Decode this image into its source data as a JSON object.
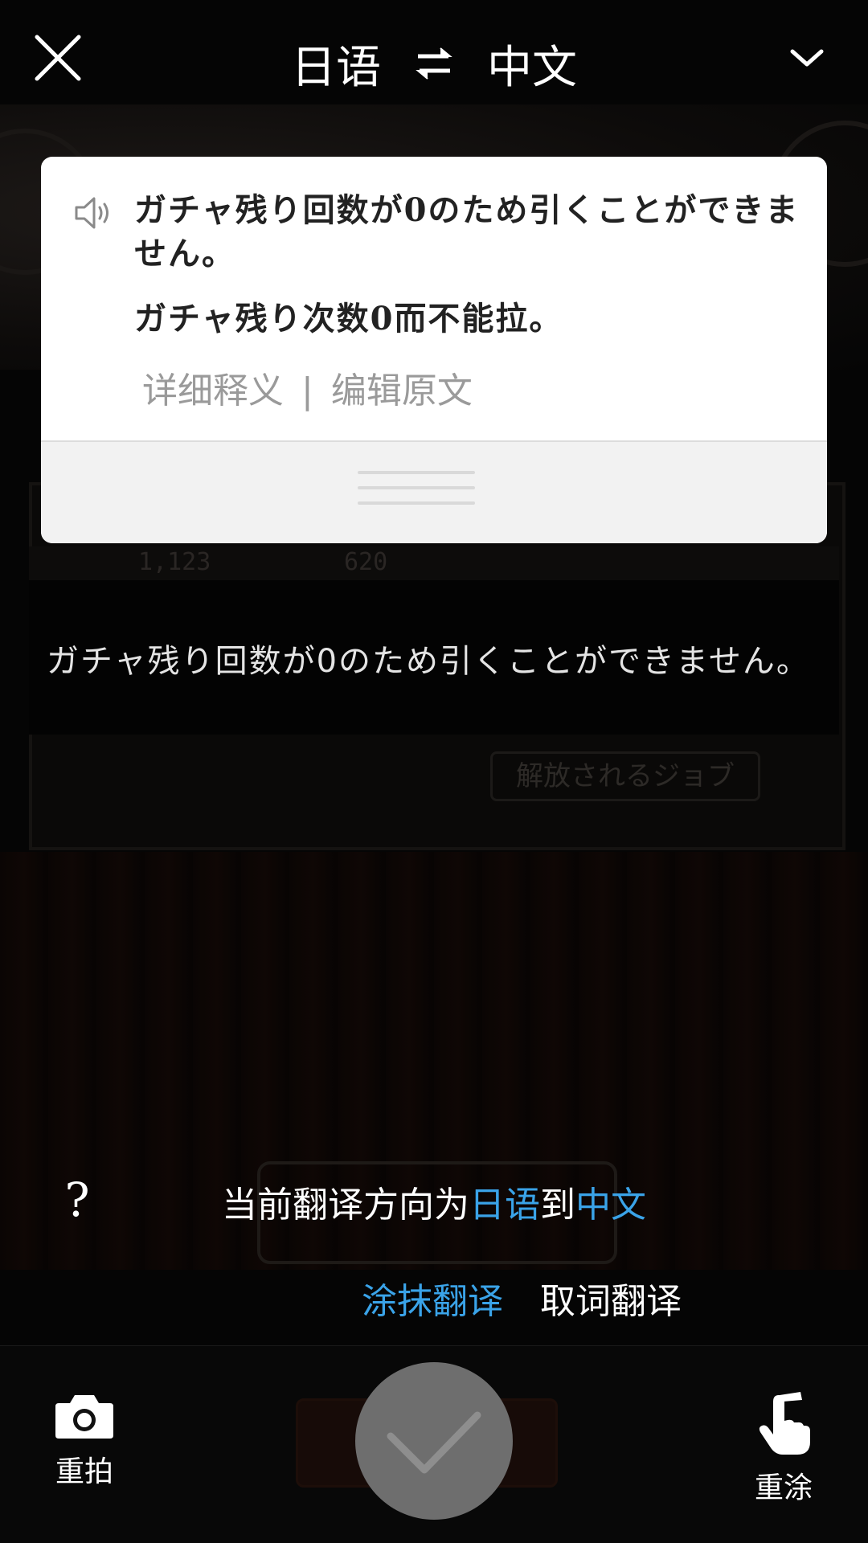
{
  "header": {
    "source_lang": "日语",
    "target_lang": "中文"
  },
  "card": {
    "source_text": "ガチャ残り回数が0のため引くことができません。",
    "translation": "ガチャ残り次数0而不能拉。",
    "detail_link": "详细释义",
    "separator": "|",
    "edit_link": "编辑原文"
  },
  "ocr": {
    "text": "ガチャ残り回数が0のため引くことができません。"
  },
  "background": {
    "stat1": "1,123",
    "stat2": "620",
    "job_tag": "解放されるジョブ"
  },
  "hint": {
    "help": "?",
    "prefix": "当前翻译方向为",
    "source": "日语",
    "middle": "到",
    "target": "中文"
  },
  "modes": {
    "smear": "涂抹翻译",
    "word": "取词翻译"
  },
  "actions": {
    "retake": "重拍",
    "repaint": "重涂"
  },
  "colors": {
    "accent": "#3aa3e8",
    "confirm": "#6e6e6e"
  },
  "icons": [
    "close-icon",
    "swap-icon",
    "chevron-down-icon",
    "speaker-icon",
    "help-icon",
    "camera-icon",
    "hand-pointer-icon",
    "check-icon"
  ]
}
